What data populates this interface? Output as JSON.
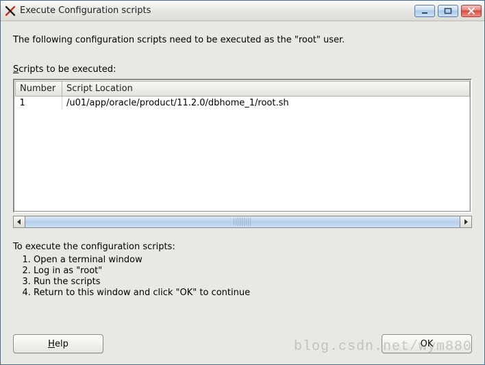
{
  "window": {
    "title": "Execute Configuration scripts"
  },
  "message": "The following configuration scripts need to be executed as the \"root\" user.",
  "scripts_label_prefix": "S",
  "scripts_label_rest": "cripts to be executed:",
  "table": {
    "headers": {
      "number": "Number",
      "location": "Script Location"
    },
    "rows": [
      {
        "number": "1",
        "location": "/u01/app/oracle/product/11.2.0/dbhome_1/root.sh"
      }
    ]
  },
  "instructions": {
    "lead": "To execute the configuration scripts:",
    "steps": [
      "Open a terminal window",
      "Log in as \"root\"",
      "Run the scripts",
      "Return to this window and click \"OK\" to continue"
    ]
  },
  "buttons": {
    "help_underline": "H",
    "help_rest": "elp",
    "ok": "OK"
  },
  "watermark": "blog.csdn.net/wym880"
}
